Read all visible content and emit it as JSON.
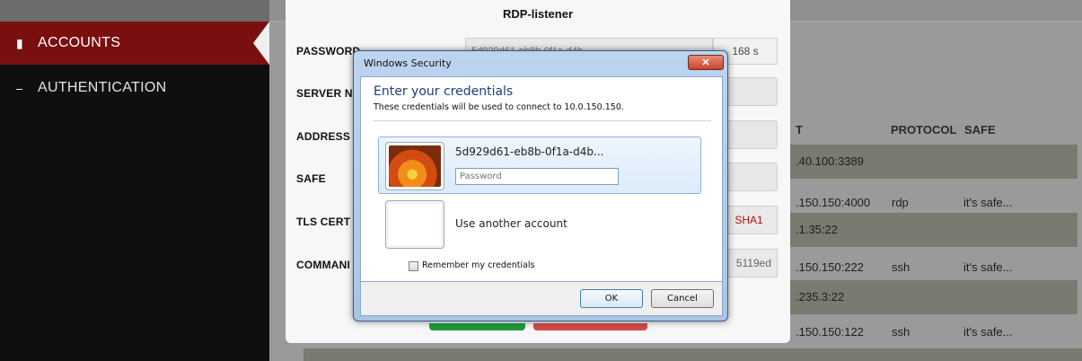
{
  "sidebar": {
    "items": [
      {
        "label": "ACCOUNTS",
        "icon": "book-icon",
        "active": true
      },
      {
        "label": "AUTHENTICATION",
        "icon": "key-icon",
        "active": false
      }
    ]
  },
  "modal": {
    "title": "RDP-listener",
    "fields": {
      "password_label": "PASSWORD",
      "password_timer": "168 s",
      "server_label": "SERVER N",
      "address_label": "ADDRESS",
      "safe_label": "SAFE",
      "tls_label": "TLS CERT",
      "tls_value": "SHA1",
      "command_label": "COMMANI",
      "command_value": "5119ed"
    }
  },
  "table": {
    "headers": {
      "address": "T",
      "protocol": "PROTOCOL",
      "safe": "SAFE"
    },
    "rows": [
      {
        "address": ".40.100:3389",
        "protocol": "",
        "safe": ""
      },
      {
        "address": ".150.150:4000",
        "protocol": "rdp",
        "safe": "it's safe..."
      },
      {
        "address": ".1.35:22",
        "protocol": "",
        "safe": ""
      },
      {
        "address": ".150.150:222",
        "protocol": "ssh",
        "safe": "it's safe..."
      },
      {
        "address": ".235.3:22",
        "protocol": "",
        "safe": ""
      },
      {
        "address": ".150.150:122",
        "protocol": "ssh",
        "safe": "it's safe..."
      }
    ]
  },
  "windows_dialog": {
    "title": "Windows Security",
    "close_label": "✕",
    "heading": "Enter your credentials",
    "subtext": "These credentials will be used to connect to 10.0.150.150.",
    "user_name": "5d929d61-eb8b-0f1a-d4b...",
    "password_placeholder": "Password",
    "other_account": "Use another account",
    "remember_label": "Remember my credentials",
    "ok_label": "OK",
    "cancel_label": "Cancel"
  }
}
